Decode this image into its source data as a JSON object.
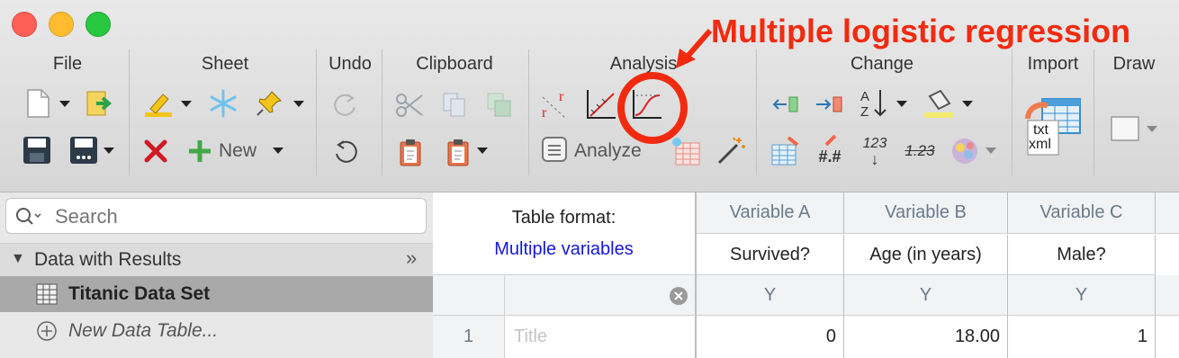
{
  "annotation": "Multiple logistic regression",
  "toolbar": {
    "groups": {
      "file": "File",
      "sheet": "Sheet",
      "undo": "Undo",
      "clipboard": "Clipboard",
      "analysis": "Analysis",
      "change": "Change",
      "import": "Import",
      "draw": "Draw"
    },
    "new_label": "New",
    "analyze_label": "Analyze",
    "txt_label": "txt",
    "xml_label": "xml",
    "change_number_label": "#.#",
    "change_123_label": "123",
    "change_123_strike_label": "1.23",
    "sort_az_label": "A Z"
  },
  "sidebar": {
    "search_placeholder": "Search",
    "section_title": "Data with Results",
    "collapse_glyph": "»",
    "items": [
      {
        "label": "Titanic Data Set",
        "selected": true
      },
      {
        "label": "New Data Table...",
        "selected": false
      }
    ]
  },
  "table": {
    "format_label": "Table format:",
    "format_value": "Multiple variables",
    "columns": [
      {
        "header": "Variable A",
        "subheader": "Survived?",
        "type": "Y"
      },
      {
        "header": "Variable B",
        "subheader": "Age (in years)",
        "type": "Y"
      },
      {
        "header": "Variable C",
        "subheader": "Male?",
        "type": "Y"
      }
    ],
    "rows": [
      {
        "number": "1",
        "title_placeholder": "Title",
        "values": [
          "0",
          "18.00",
          "1"
        ]
      }
    ]
  },
  "colors": {
    "accent_red": "#f22b10",
    "format_blue": "#1518d6",
    "header_gray": "#6b7a8a"
  }
}
